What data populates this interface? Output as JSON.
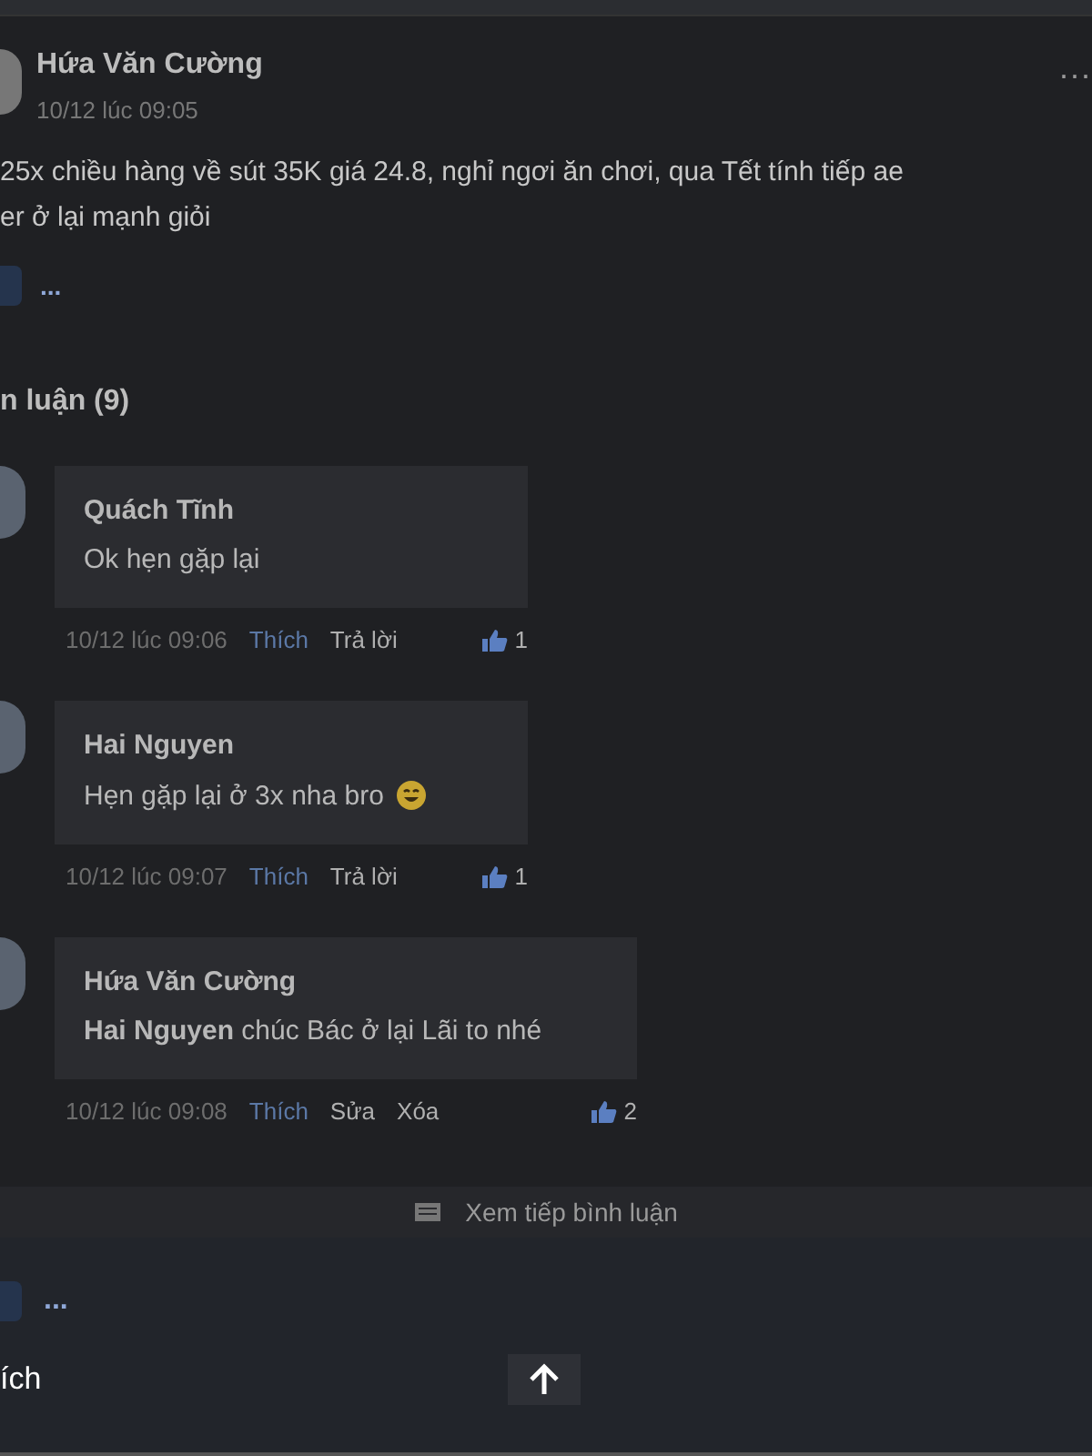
{
  "post": {
    "author": "Hứa Văn Cường",
    "time": "10/12 lúc 09:05",
    "more": "...",
    "lines": [
      "25x chiều hàng về sút 35K giá 24.8, nghỉ ngơi ăn chơi, qua Tết tính tiếp ae",
      "er ở lại mạnh giỏi"
    ],
    "actions_more": "..."
  },
  "comments_heading": "n luận (9)",
  "comments": [
    {
      "author": "Quách Tĩnh",
      "text": "Ok hẹn gặp lại",
      "emoji": false,
      "time": "10/12 lúc 09:06",
      "like": "Thích",
      "actions": [
        "Trả lời"
      ],
      "likes": "1"
    },
    {
      "author": "Hai Nguyen",
      "text": "Hẹn gặp lại ở 3x nha bro",
      "emoji": true,
      "time": "10/12 lúc 09:07",
      "like": "Thích",
      "actions": [
        "Trả lời"
      ],
      "likes": "1"
    },
    {
      "author": "Hứa Văn Cường",
      "text": "**Hai Nguyen** chúc Bác ở lại Lãi to nhé",
      "emoji": false,
      "time": "10/12 lúc 09:08",
      "like": "Thích",
      "actions": [
        "Sửa",
        "Xóa"
      ],
      "likes": "2"
    }
  ],
  "more_comments": "Xem tiếp bình luận",
  "footer": {
    "more": "...",
    "label": "ích"
  }
}
